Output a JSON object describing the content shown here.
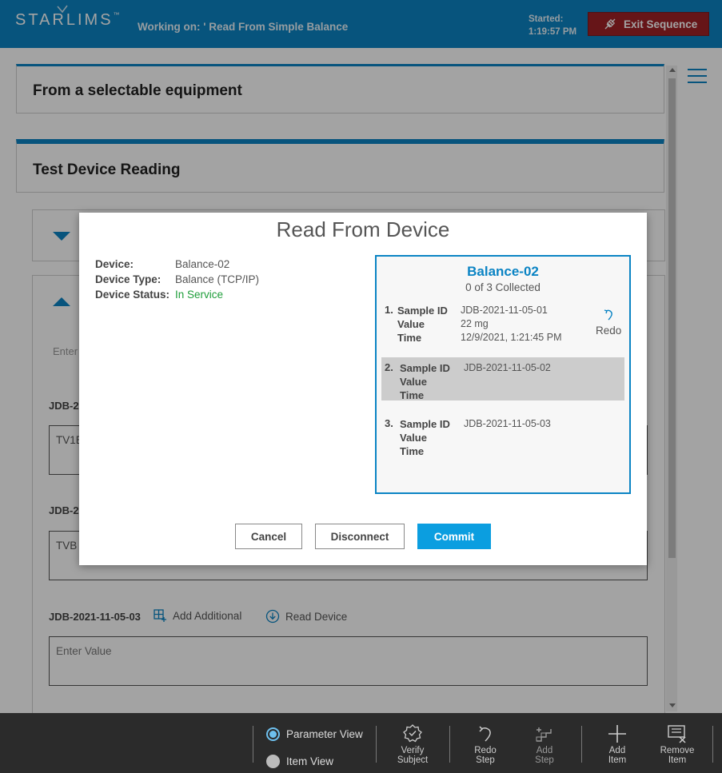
{
  "header": {
    "logo": "STARLIMS",
    "logo_tm": "™",
    "working_on": "Working on: ' Read From Simple Balance",
    "started_label": "Started:",
    "started_time": "1:19:57 PM",
    "exit_button": "Exit Sequence"
  },
  "main": {
    "panel1_title": "From a selectable equipment",
    "panel2_title": "Test Device Reading",
    "bg_enter": "Enter",
    "rows": [
      {
        "label": "JDB-2",
        "value": "TV1E"
      },
      {
        "label": "JDB-2",
        "value": "TVB"
      },
      {
        "label": "JDB-2021-11-05-03",
        "placeholder": "Enter Value"
      }
    ],
    "add_additional": "Add Additional",
    "read_device": "Read Device"
  },
  "modal": {
    "title": "Read From Device",
    "device_label": "Device:",
    "device_value": "Balance-02",
    "type_label": "Device Type:",
    "type_value": "Balance (TCP/IP)",
    "status_label": "Device Status:",
    "status_value": "In Service",
    "card": {
      "title": "Balance-02",
      "collected": "0 of 3 Collected",
      "samples": [
        {
          "num": "1.",
          "k1": "Sample ID",
          "k2": "Value",
          "k3": "Time",
          "id": "JDB-2021-11-05-01",
          "value": "22 mg",
          "time": "12/9/2021, 1:21:45 PM",
          "action": "Redo"
        },
        {
          "num": "2.",
          "k1": "Sample ID",
          "k2": "Value",
          "k3": "Time",
          "id": "JDB-2021-11-05-02"
        },
        {
          "num": "3.",
          "k1": "Sample ID",
          "k2": "Value",
          "k3": "Time",
          "id": "JDB-2021-11-05-03"
        }
      ]
    },
    "cancel": "Cancel",
    "disconnect": "Disconnect",
    "commit": "Commit"
  },
  "toolbar": {
    "parameter_view": "Parameter View",
    "item_view": "Item View",
    "verify_1": "Verify",
    "verify_2": "Subject",
    "redo_1": "Redo",
    "redo_2": "Step",
    "addstep_1": "Add",
    "addstep_2": "Step",
    "additem_1": "Add",
    "additem_2": "Item",
    "remove_1": "Remove",
    "remove_2": "Item"
  },
  "colors": {
    "brand": "#0b84c4",
    "exit": "#a02127",
    "commit": "#0b9ee0",
    "status_ok": "#1e9e3a"
  }
}
